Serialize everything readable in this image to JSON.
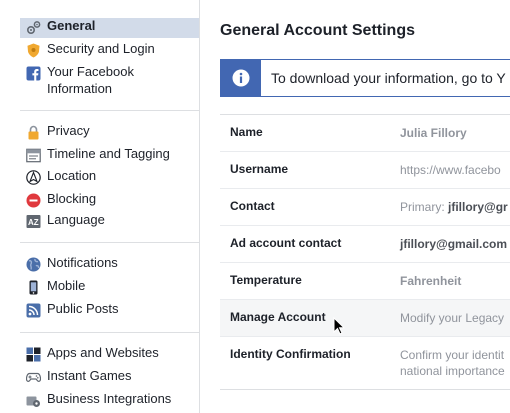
{
  "colors": {
    "accent": "#4267b2",
    "active_bg": "#d2dbe9",
    "border": "#dddfe2"
  },
  "sidebar": {
    "items": [
      {
        "label": "General",
        "icon": "gear-icon",
        "active": true
      },
      {
        "label": "Security and Login",
        "icon": "shield-icon"
      },
      {
        "label": "Your Facebook\nInformation",
        "icon": "facebook-icon"
      },
      {
        "label": "Privacy",
        "icon": "lock-icon"
      },
      {
        "label": "Timeline and Tagging",
        "icon": "timeline-icon"
      },
      {
        "label": "Location",
        "icon": "location-icon"
      },
      {
        "label": "Blocking",
        "icon": "blocking-icon"
      },
      {
        "label": "Language",
        "icon": "language-icon"
      },
      {
        "label": "Notifications",
        "icon": "globe-icon"
      },
      {
        "label": "Mobile",
        "icon": "mobile-icon"
      },
      {
        "label": "Public Posts",
        "icon": "rss-icon"
      },
      {
        "label": "Apps and Websites",
        "icon": "apps-icon"
      },
      {
        "label": "Instant Games",
        "icon": "gamepad-icon"
      },
      {
        "label": "Business Integrations",
        "icon": "business-gear-icon"
      }
    ]
  },
  "main": {
    "title": "General Account Settings",
    "info_banner": {
      "icon": "info-icon",
      "text": "To download your information, go to Y"
    },
    "settings": [
      {
        "key": "Name",
        "value": "Julia Fillory",
        "style": "grey-bold"
      },
      {
        "key": "Username",
        "value": "https://www.facebo"
      },
      {
        "key": "Contact",
        "value_prefix": "Primary: ",
        "value": "jfillory@gr"
      },
      {
        "key": "Ad account contact",
        "value": "jfillory@gmail.com",
        "style": "dark"
      },
      {
        "key": "Temperature",
        "value": "Fahrenheit",
        "style": "grey-bold"
      },
      {
        "key": "Manage Account",
        "value": "Modify your Legacy"
      },
      {
        "key": "Identity Confirmation",
        "value": "Confirm your identit",
        "value_line2": "national importance"
      }
    ]
  }
}
